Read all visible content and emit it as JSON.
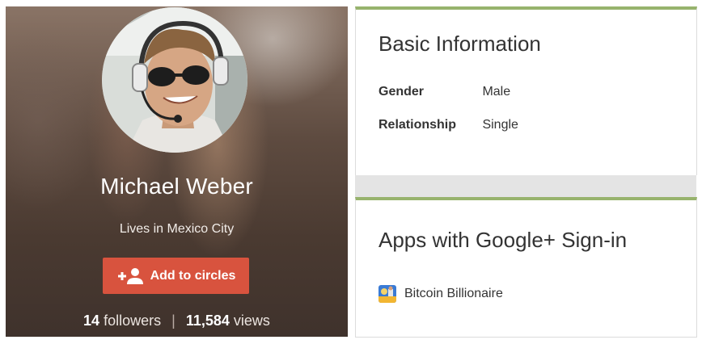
{
  "profile": {
    "name": "Michael Weber",
    "location": "Lives in Mexico City",
    "add_button_label": "Add to circles",
    "followers_count": "14",
    "followers_label": "followers",
    "separator": "|",
    "views_count": "11,584",
    "views_label": "views"
  },
  "basic_information": {
    "title": "Basic Information",
    "rows": [
      {
        "label": "Gender",
        "value": "Male"
      },
      {
        "label": "Relationship",
        "value": "Single"
      }
    ]
  },
  "apps": {
    "title": "Apps with Google+ Sign-in",
    "items": [
      {
        "name": "Bitcoin Billionaire",
        "icon": "bitcoin-billionaire-app-icon"
      }
    ]
  },
  "colors": {
    "card_accent": "#97b36d",
    "add_button": "#d8533e"
  }
}
